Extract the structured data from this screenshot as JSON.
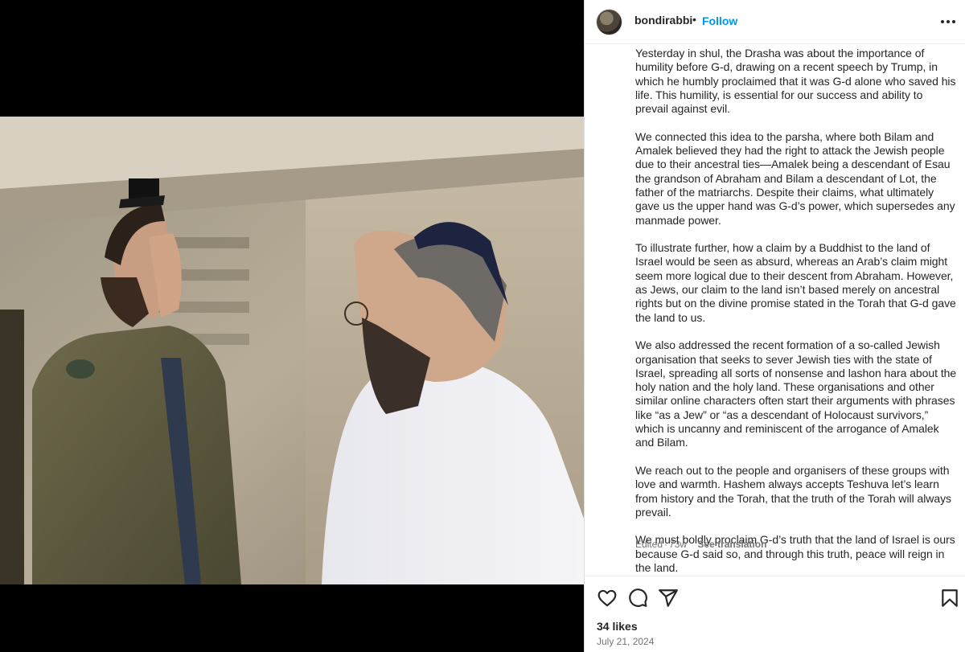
{
  "header": {
    "username": "bondirabbi",
    "separator": "•",
    "follow_label": "Follow",
    "more_icon": "more-horizontal-icon"
  },
  "caption": {
    "paragraphs": [
      "Yesterday in shul, the Drasha was about the importance of humility before G-d, drawing on a recent speech by Trump, in which he humbly proclaimed that it was G-d alone who saved his life. This humility, is essential for our success and ability to prevail against evil.",
      "We connected this idea to the parsha, where both Bilam and Amalek believed they had the right to attack the Jewish people due to their ancestral ties—Amalek being a descendant of Esau the grandson of Abraham and Bilam a descendant of Lot, the father of the matriarchs. Despite their claims, what ultimately gave us the upper hand was G-d’s power, which supersedes any manmade power.",
      "To illustrate further, how a claim by a Buddhist to the land of Israel would be seen as absurd, whereas an Arab’s claim might seem more logical due to their descent from Abraham. However, as Jews, our claim to the land isn’t based merely on ancestral rights but on the divine promise stated in the Torah that G-d gave the land to us.",
      "We also addressed the recent formation of a so-called Jewish organisation that seeks to sever Jewish ties with the state of Israel, spreading all sorts of nonsense and lashon hara about the holy nation and the holy land. These organisations and other similar online characters often start their arguments with phrases like “as a Jew” or “as a descendant of Holocaust survivors,” which is uncanny and reminiscent of the arrogance of Amalek and Bilam.",
      "We reach out to the people and organisers of these groups with love and warmth. Hashem always accepts Teshuva let’s learn from history and the Torah, that the truth of the Torah will always prevail.",
      "We must boldly proclaim G-d’s truth that the land of Israel is ours because G-d said so, and through this truth, peace will reign in the land."
    ],
    "edited_label": "Edited",
    "meta_separator": "·",
    "age": "73w",
    "see_translation": "See translation"
  },
  "actions": {
    "like_icon": "heart-icon",
    "comment_icon": "comment-icon",
    "share_icon": "share-icon",
    "save_icon": "bookmark-icon"
  },
  "likes": "34 likes",
  "date": "July 21, 2024",
  "colors": {
    "link": "#0095f6",
    "text": "#262626",
    "muted": "#737373",
    "border": "#dbdbdb"
  }
}
